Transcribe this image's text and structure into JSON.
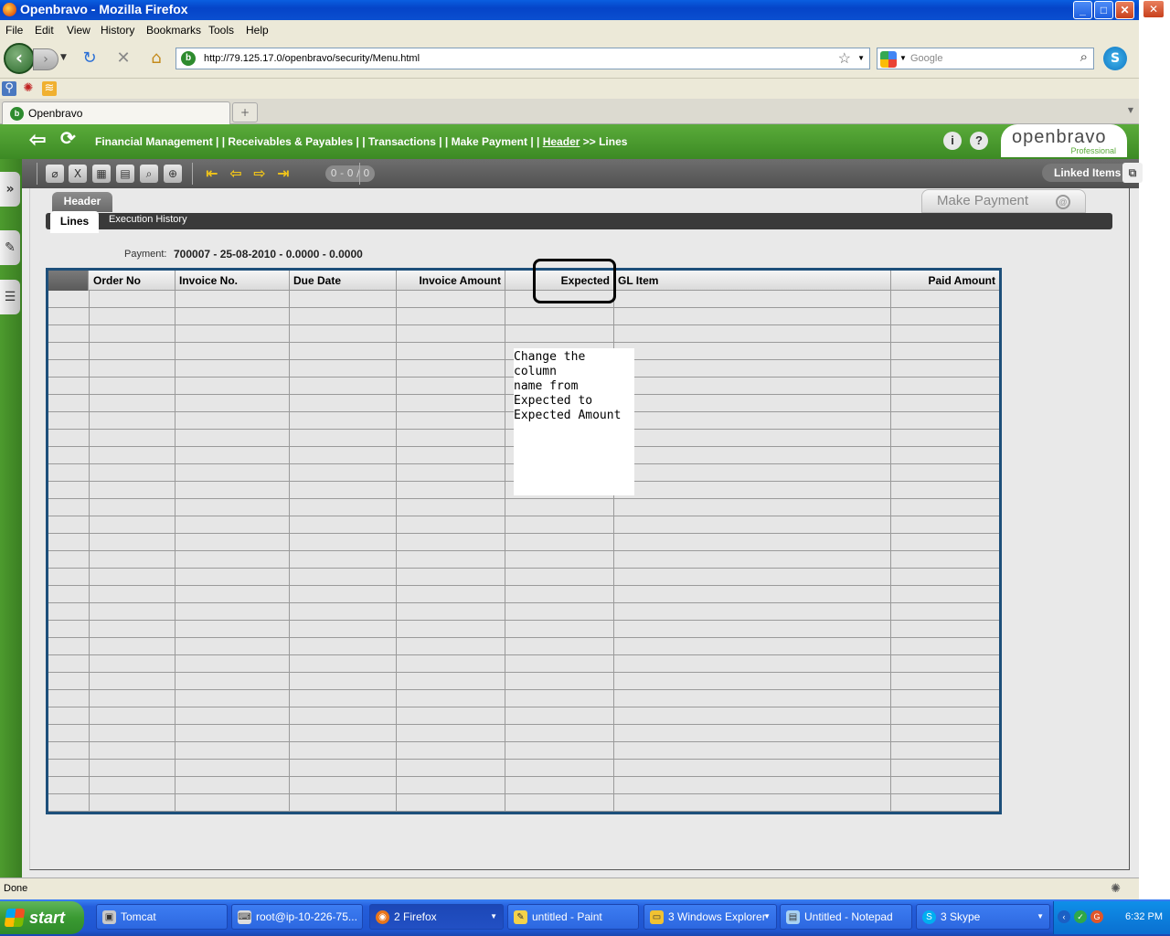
{
  "window": {
    "title": "Openbravo - Mozilla Firefox"
  },
  "menubar": [
    "File",
    "Edit",
    "View",
    "History",
    "Bookmarks",
    "Tools",
    "Help"
  ],
  "nav": {
    "url": "http://79.125.17.0/openbravo/security/Menu.html",
    "search_placeholder": "Google"
  },
  "browser_tabs": [
    {
      "label": "Openbravo"
    }
  ],
  "app": {
    "breadcrumb": {
      "path": "Financial Management  | |  Receivables & Payables  | |  Transactions  | |  Make Payment   | | ",
      "link": "Header",
      "tail": "  >>  Lines"
    },
    "logo": {
      "brand": "openbravo",
      "edition": "Professional"
    },
    "toolbar": {
      "pager": "0 - 0 / 0",
      "linked_items": "Linked Items"
    },
    "window_tab": "Make Payment",
    "header_tab": "Header",
    "subtabs": {
      "lines": "Lines",
      "execution_history": "Execution History"
    },
    "payment": {
      "label": "Payment:",
      "value": "700007 - 25-08-2010 - 0.0000 - 0.0000"
    },
    "grid": {
      "columns": [
        "Order No",
        "Invoice No.",
        "Due Date",
        "Invoice Amount",
        "Expected",
        "GL Item",
        "Paid Amount"
      ],
      "row_count": 30
    },
    "annotation": "Change the column\nname from\nExpected to\nExpected Amount"
  },
  "statusbar": {
    "text": "Done"
  },
  "taskbar": {
    "start": "start",
    "tasks": [
      "Tomcat",
      "root@ip-10-226-75...",
      "2 Firefox",
      "untitled - Paint",
      "3 Windows Explorer",
      "Untitled - Notepad",
      "3 Skype"
    ],
    "clock": "6:32 PM"
  }
}
